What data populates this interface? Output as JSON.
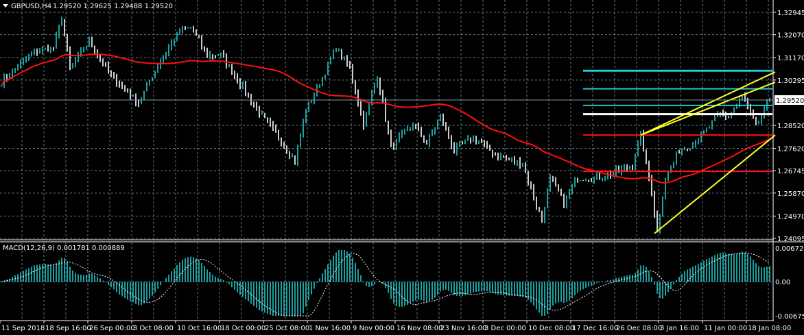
{
  "header": {
    "symbol": "GBPUSD,H4",
    "ohlc": "1.29520 1.29625 1.29488 1.29520"
  },
  "price_axis": {
    "ticks": [
      "1.32945",
      "1.32070",
      "1.31170",
      "1.30295",
      "1.29520",
      "1.28520",
      "1.27620",
      "1.26745",
      "1.25870",
      "1.24970",
      "1.24095"
    ],
    "tick_values": [
      1.32945,
      1.3207,
      1.3117,
      1.30295,
      1.2852,
      1.2762,
      1.26745,
      1.2587,
      1.2497,
      1.24095
    ],
    "current_price": "1.29520",
    "current_value": 1.2952,
    "range": [
      1.24095,
      1.32945
    ]
  },
  "macd": {
    "label": "MACD(12,26,9) 0.001781 0.000889",
    "ticks": [
      "0.006722",
      "0.00",
      "-0.006756"
    ],
    "range": [
      -0.006756,
      0.006722
    ]
  },
  "time_axis": {
    "labels": [
      "11 Sep 2018",
      "18 Sep 16:00",
      "26 Sep 00:00",
      "3 Oct 08:00",
      "10 Oct 16:00",
      "18 Oct 00:00",
      "25 Oct 08:00",
      "1 Nov 16:00",
      "9 Nov 00:00",
      "16 Nov 08:00",
      "23 Nov 16:00",
      "3 Dec 00:00",
      "10 Dec 08:00",
      "17 Dec 16:00",
      "26 Dec 08:00",
      "3 Jan 16:00",
      "11 Jan 00:00",
      "18 Jan 08:00"
    ],
    "bars_per_label": 16
  },
  "colors": {
    "background": "#000000",
    "grid": "#6b7a8a",
    "bull": "#20c8c8",
    "bear": "#ffffff",
    "ma": "#ff1010",
    "trendline": "#ffff20",
    "macd_hist": "#20c8c8",
    "signal": "#ffffff"
  },
  "price_path": [
    [
      0,
      1.3021
    ],
    [
      5,
      1.3075
    ],
    [
      12,
      1.3142
    ],
    [
      19,
      1.3155
    ],
    [
      22,
      1.3276
    ],
    [
      25,
      1.3075
    ],
    [
      32,
      1.3182
    ],
    [
      40,
      1.3048
    ],
    [
      50,
      1.2941
    ],
    [
      57,
      1.3088
    ],
    [
      65,
      1.3222
    ],
    [
      69,
      1.3236
    ],
    [
      75,
      1.3128
    ],
    [
      80,
      1.3128
    ],
    [
      85,
      1.3048
    ],
    [
      95,
      1.2887
    ],
    [
      100,
      1.282
    ],
    [
      107,
      1.2713
    ],
    [
      111,
      1.2914
    ],
    [
      115,
      1.2994
    ],
    [
      122,
      1.3155
    ],
    [
      127,
      1.3075
    ],
    [
      132,
      1.286
    ],
    [
      137,
      1.3048
    ],
    [
      142,
      1.2766
    ],
    [
      150,
      1.286
    ],
    [
      155,
      1.278
    ],
    [
      160,
      1.2887
    ],
    [
      165,
      1.2753
    ],
    [
      172,
      1.2806
    ],
    [
      180,
      1.2739
    ],
    [
      190,
      1.2699
    ],
    [
      195,
      1.2538
    ],
    [
      197,
      1.2485
    ],
    [
      200,
      1.2646
    ],
    [
      205,
      1.2552
    ],
    [
      210,
      1.2646
    ],
    [
      217,
      1.2646
    ],
    [
      225,
      1.2672
    ],
    [
      230,
      1.2699
    ],
    [
      233,
      1.2814
    ],
    [
      237,
      1.2592
    ],
    [
      239,
      1.2431
    ],
    [
      242,
      1.2646
    ],
    [
      247,
      1.2753
    ],
    [
      252,
      1.278
    ],
    [
      257,
      1.2833
    ],
    [
      262,
      1.29
    ],
    [
      265,
      1.2887
    ],
    [
      270,
      1.2967
    ],
    [
      275,
      1.2847
    ],
    [
      280,
      1.2952
    ]
  ],
  "objects": {
    "hlines": [
      {
        "price": 1.3066,
        "color": "#20c8c8",
        "from_bar": 212,
        "width": 3
      },
      {
        "price": 1.2995,
        "color": "#20c8c8",
        "from_bar": 212,
        "width": 2
      },
      {
        "price": 1.293,
        "color": "#20c8c8",
        "from_bar": 212,
        "width": 2
      },
      {
        "price": 1.2896,
        "color": "#ffffff",
        "from_bar": 212,
        "width": 3
      },
      {
        "price": 1.2814,
        "color": "#ff1010",
        "from_bar": 212,
        "width": 2
      },
      {
        "price": 1.2672,
        "color": "#ff1010",
        "from_bar": 212,
        "width": 2
      }
    ],
    "trendlines": [
      {
        "from": [
          233,
          1.2814
        ],
        "to": [
          282,
          1.3061
        ]
      },
      {
        "from": [
          233,
          1.2814
        ],
        "to": [
          282,
          1.3021
        ]
      },
      {
        "from": [
          238,
          1.2429
        ],
        "to": [
          282,
          1.2814
        ]
      }
    ]
  }
}
